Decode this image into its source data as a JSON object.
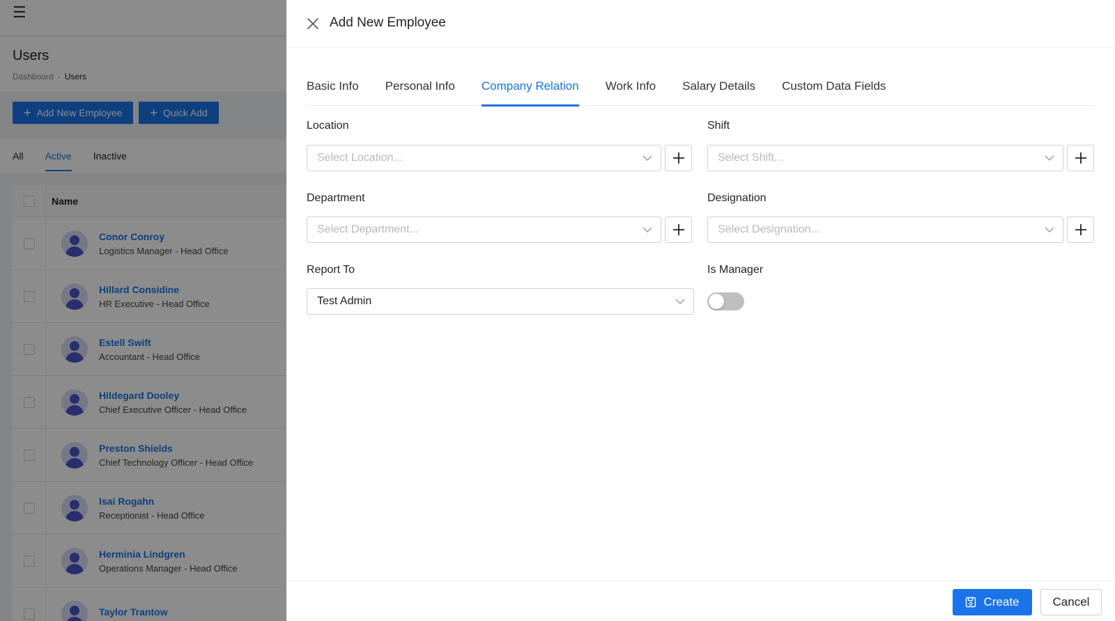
{
  "background": {
    "page_title": "Users",
    "breadcrumb": {
      "root": "Dashboard",
      "separator": "-",
      "current": "Users"
    },
    "buttons": {
      "add_employee": "Add New Employee",
      "quick_add": "Quick Add"
    },
    "filter_tabs": [
      "All",
      "Active",
      "Inactive"
    ],
    "active_filter": "Active",
    "table_header": "Name",
    "rows": [
      {
        "name": "Conor Conroy",
        "sub": "Logistics Manager - Head Office"
      },
      {
        "name": "Hillard Considine",
        "sub": "HR Executive - Head Office"
      },
      {
        "name": "Estell Swift",
        "sub": "Accountant - Head Office"
      },
      {
        "name": "Hildegard Dooley",
        "sub": "Chief Executive Officer - Head Office"
      },
      {
        "name": "Preston Shields",
        "sub": "Chief Technology Officer - Head Office"
      },
      {
        "name": "Isai Rogahn",
        "sub": "Receptionist - Head Office"
      },
      {
        "name": "Herminia Lindgren",
        "sub": "Operations Manager - Head Office"
      },
      {
        "name": "Taylor Trantow",
        "sub": ""
      }
    ]
  },
  "drawer": {
    "title": "Add New Employee",
    "tabs": [
      "Basic Info",
      "Personal Info",
      "Company Relation",
      "Work Info",
      "Salary Details",
      "Custom Data Fields"
    ],
    "active_tab": "Company Relation",
    "fields": {
      "location": {
        "label": "Location",
        "placeholder": "Select Location..."
      },
      "shift": {
        "label": "Shift",
        "placeholder": "Select Shift..."
      },
      "department": {
        "label": "Department",
        "placeholder": "Select Department..."
      },
      "designation": {
        "label": "Designation",
        "placeholder": "Select Designation..."
      },
      "report_to": {
        "label": "Report To",
        "value": "Test Admin"
      },
      "is_manager": {
        "label": "Is Manager",
        "checked": false
      }
    },
    "footer": {
      "create_label": "Create",
      "cancel_label": "Cancel"
    }
  },
  "colors": {
    "accent": "#1a73e8",
    "overlay": "rgba(0,0,0,0.45)",
    "avatar_bg": "#d7dbf5",
    "avatar_fg": "#4a54c9"
  },
  "icons": {
    "menu": "hamburger-icon",
    "close": "close-icon",
    "chevron": "chevron-down-icon",
    "add": "plus-icon",
    "save": "save-icon",
    "avatar": "user-avatar-icon"
  }
}
